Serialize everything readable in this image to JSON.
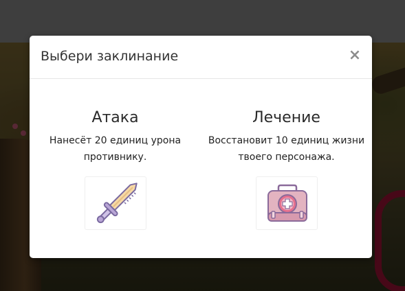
{
  "modal": {
    "title": "Выбери заклинание",
    "close_label": "×"
  },
  "spells": [
    {
      "name": "Атака",
      "description": "Нанесёт 20 единиц урона противнику.",
      "icon": "sword-icon"
    },
    {
      "name": "Лечение",
      "description": "Восстановит 10 единиц жизни твоего персонажа.",
      "icon": "first-aid-kit-icon"
    }
  ],
  "colors": {
    "backdrop": "#7d7d7d",
    "modal_bg": "#ffffff",
    "header_border": "#e5e5e5",
    "close_icon": "#8c8c8c",
    "accent_red": "#8e1030",
    "kit_pink": "#d9a7b5",
    "sword_blade": "#f6d9a6",
    "sword_outline": "#7a6aa0"
  }
}
